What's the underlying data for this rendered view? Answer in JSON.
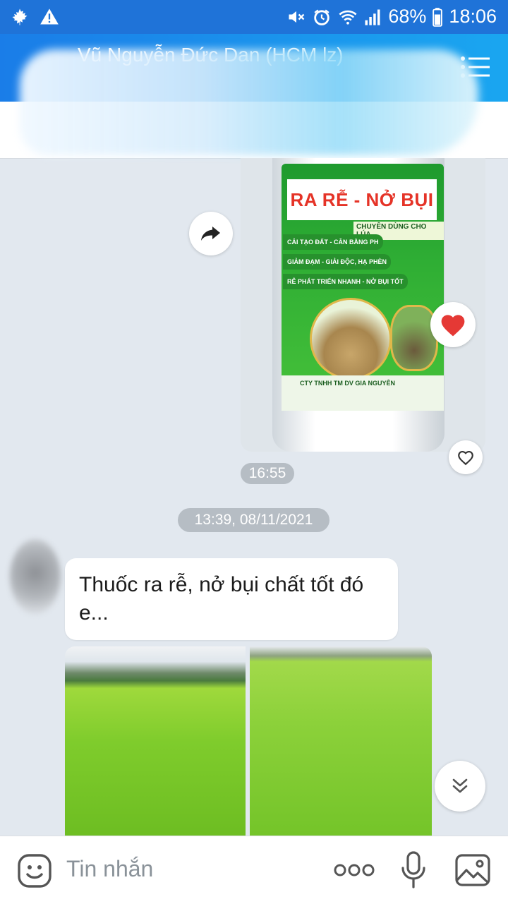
{
  "status_bar": {
    "battery": "68%",
    "time": "18:06",
    "icons": [
      "maple-leaf-icon",
      "warning-icon",
      "mute-icon",
      "alarm-icon",
      "wifi-icon",
      "signal-icon",
      "battery-icon"
    ]
  },
  "header": {
    "title": "Vũ Nguyễn Đức Dan (HCM lz)",
    "menu_icon": "list-menu-icon"
  },
  "product_image": {
    "title": "RA RỄ - NỞ BỤI",
    "subtitle": "CHUYÊN DÙNG CHO LÚA",
    "tags": [
      "CẢI TẠO ĐẤT - CÂN BẰNG PH",
      "GIẢM ĐẠM - GIẢI ĐỘC, HẠ PHÈN",
      "RỄ PHÁT TRIỂN NHANH - NỞ BỤI TỐT"
    ],
    "company": "CTY TNHH TM DV GIA NGUYÊN"
  },
  "messages": {
    "time_1": "16:55",
    "date_separator": "13:39, 08/11/2021",
    "text_1": "Thuốc ra rễ, nở bụi chất tốt đó e..."
  },
  "input_bar": {
    "placeholder": "Tin nhắn"
  },
  "colors": {
    "accent": "#1f73d8",
    "chat_bg": "#e2e8ef",
    "heart": "#e53935"
  }
}
